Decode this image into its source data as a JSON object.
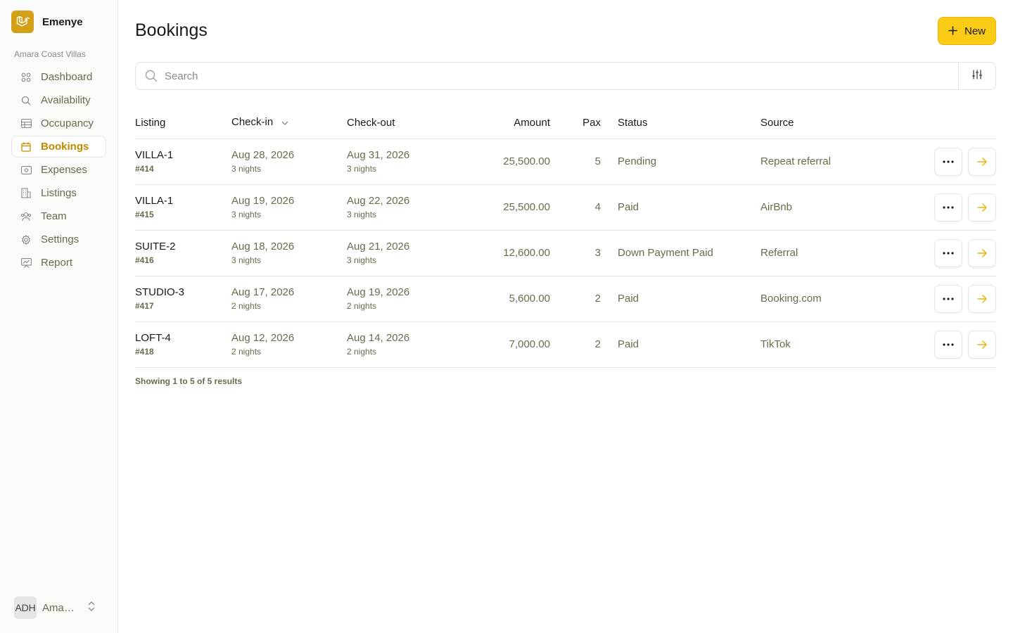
{
  "brand": {
    "name": "Emenye",
    "logo_icon": "laravel-icon",
    "color": "#d4a017"
  },
  "sidebar": {
    "org_label": "Amara Coast Villas",
    "items": [
      {
        "label": "Dashboard",
        "icon": "grid-icon"
      },
      {
        "label": "Availability",
        "icon": "search-icon"
      },
      {
        "label": "Occupancy",
        "icon": "table-icon"
      },
      {
        "label": "Bookings",
        "icon": "calendar-icon",
        "active": true
      },
      {
        "label": "Expenses",
        "icon": "banknote-icon"
      },
      {
        "label": "Listings",
        "icon": "building-icon"
      },
      {
        "label": "Team",
        "icon": "users-icon"
      },
      {
        "label": "Settings",
        "icon": "gear-icon"
      },
      {
        "label": "Report",
        "icon": "chart-icon"
      }
    ],
    "user": {
      "initials": "ADH",
      "name": "Amara Coast Villas"
    }
  },
  "header": {
    "title": "Bookings",
    "new_label": "New"
  },
  "search": {
    "placeholder": "Search"
  },
  "table": {
    "columns": {
      "listing": "Listing",
      "checkin": "Check-in",
      "checkout": "Check-out",
      "amount": "Amount",
      "pax": "Pax",
      "status": "Status",
      "source": "Source"
    },
    "rows": [
      {
        "listing": "VILLA-1",
        "id": "#414",
        "checkin": "Aug 28, 2026",
        "checkin_nights": "3 nights",
        "checkout": "Aug 31, 2026",
        "checkout_nights": "3 nights",
        "amount": "25,500.00",
        "pax": "5",
        "status": "Pending",
        "source": "Repeat referral"
      },
      {
        "listing": "VILLA-1",
        "id": "#415",
        "checkin": "Aug 19, 2026",
        "checkin_nights": "3 nights",
        "checkout": "Aug 22, 2026",
        "checkout_nights": "3 nights",
        "amount": "25,500.00",
        "pax": "4",
        "status": "Paid",
        "source": "AirBnb"
      },
      {
        "listing": "SUITE-2",
        "id": "#416",
        "checkin": "Aug 18, 2026",
        "checkin_nights": "3 nights",
        "checkout": "Aug 21, 2026",
        "checkout_nights": "3 nights",
        "amount": "12,600.00",
        "pax": "3",
        "status": "Down Payment Paid",
        "source": "Referral"
      },
      {
        "listing": "STUDIO-3",
        "id": "#417",
        "checkin": "Aug 17, 2026",
        "checkin_nights": "2 nights",
        "checkout": "Aug 19, 2026",
        "checkout_nights": "2 nights",
        "amount": "5,600.00",
        "pax": "2",
        "status": "Paid",
        "source": "Booking.com"
      },
      {
        "listing": "LOFT-4",
        "id": "#418",
        "checkin": "Aug 12, 2026",
        "checkin_nights": "2 nights",
        "checkout": "Aug 14, 2026",
        "checkout_nights": "2 nights",
        "amount": "7,000.00",
        "pax": "2",
        "status": "Paid",
        "source": "TikTok"
      }
    ]
  },
  "footer": {
    "results_text": "Showing 1 to 5 of 5 results"
  },
  "colors": {
    "accent": "#facc15",
    "accent_text": "#c28a00",
    "muted": "#6b6b4e"
  }
}
